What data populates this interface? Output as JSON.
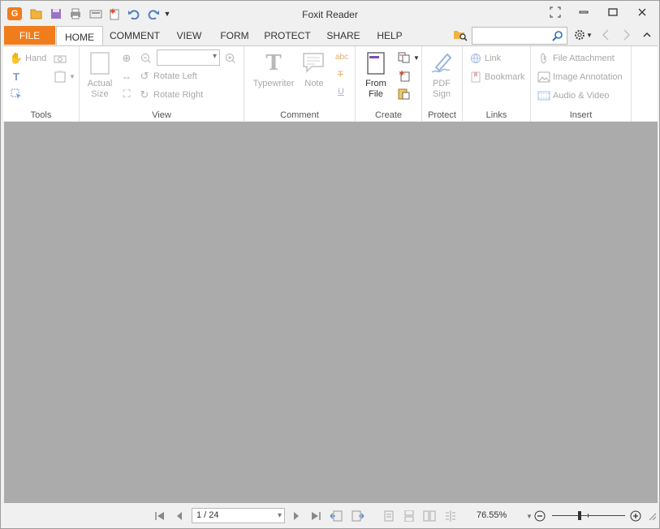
{
  "window": {
    "title": "Foxit Reader",
    "app_icon_glyph": "G"
  },
  "quick_access": [
    "open-folder-icon",
    "save-icon",
    "print-icon",
    "scan-icon",
    "new-icon",
    "undo-icon",
    "redo-icon",
    "customize-dropdown-icon"
  ],
  "tabs": [
    {
      "label": "FILE"
    },
    {
      "label": "HOME"
    },
    {
      "label": "COMMENT"
    },
    {
      "label": "VIEW"
    },
    {
      "label": "FORM"
    },
    {
      "label": "PROTECT"
    },
    {
      "label": "SHARE"
    },
    {
      "label": "HELP"
    }
  ],
  "search": {
    "value": ""
  },
  "ribbon": {
    "tools": {
      "label": "Tools",
      "hand": "Hand"
    },
    "view": {
      "label": "View",
      "actual_size": "Actual\nSize",
      "rotate_left": "Rotate Left",
      "rotate_right": "Rotate Right",
      "zoom_value": ""
    },
    "comment": {
      "label": "Comment",
      "typewriter": "Typewriter",
      "note": "Note",
      "highlight_text": "abc",
      "strike_text": "T",
      "underline_text": "U"
    },
    "create": {
      "label": "Create",
      "from_file": "From\nFile"
    },
    "protect": {
      "label": "Protect",
      "pdf_sign": "PDF\nSign"
    },
    "links": {
      "label": "Links",
      "link": "Link",
      "bookmark": "Bookmark"
    },
    "insert": {
      "label": "Insert",
      "file_attachment": "File Attachment",
      "image_annotation": "Image Annotation",
      "audio_video": "Audio & Video"
    }
  },
  "status": {
    "page": "1 / 24",
    "zoom": "76.55%",
    "zoom_level_percent": 76.55
  },
  "colors": {
    "accent": "#f07c1b",
    "doc_bg": "#ababab"
  }
}
